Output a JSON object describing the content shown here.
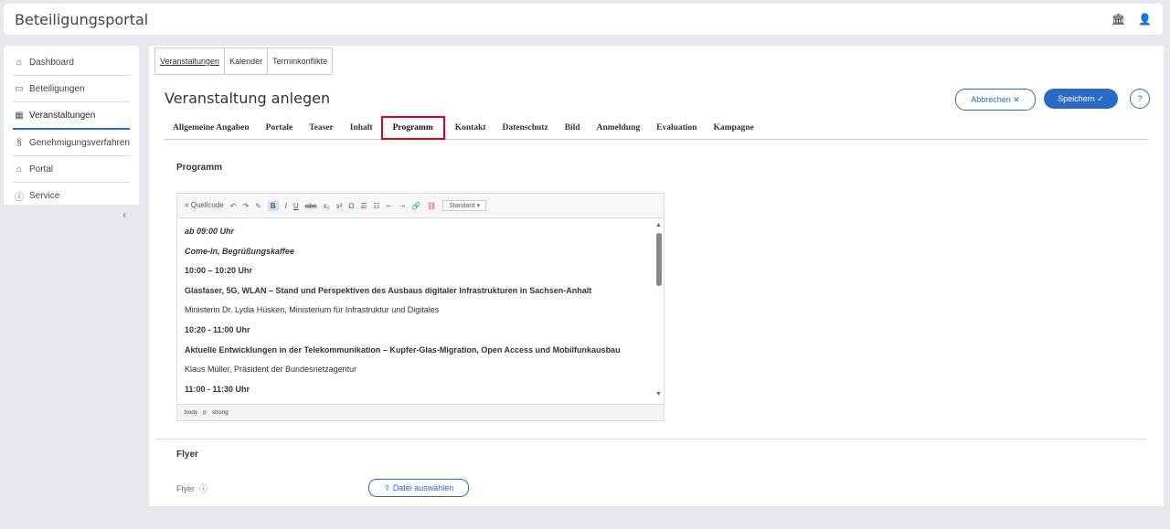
{
  "app": {
    "title": "Beteiligungsportal"
  },
  "sidebar": {
    "items": [
      {
        "icon": "home-icon",
        "label": "Dashboard"
      },
      {
        "icon": "chat-icon",
        "label": "Beteiligungen"
      },
      {
        "icon": "calendar-icon",
        "label": "Veranstaltungen"
      },
      {
        "icon": "paragraph-icon",
        "label": "Genehmigungsverfahren"
      },
      {
        "icon": "building-icon",
        "label": "Portal"
      },
      {
        "icon": "info-icon",
        "label": "Service"
      }
    ],
    "active_index": 2
  },
  "subtabs": [
    "Veranstaltungen",
    "Kalender",
    "Terminkonflikte"
  ],
  "page": {
    "title": "Veranstaltung anlegen",
    "cancel_label": "Abbrechen",
    "save_label": "Speichern"
  },
  "tabs": [
    "Allgemeine Angaben",
    "Portale",
    "Teaser",
    "Inhalt",
    "Programm",
    "Kontakt",
    "Datenschutz",
    "Bild",
    "Anmeldung",
    "Evaluation",
    "Kampagne"
  ],
  "selected_tab": "Programm",
  "program": {
    "section_title": "Programm",
    "toolbar": {
      "source_label": "Quellcode",
      "format_select": "Standard"
    },
    "content": [
      {
        "text": "ab 09:00 Uhr",
        "style": "bi"
      },
      {
        "text": "Come-In, Begrüßungskaffee",
        "style": "bi"
      },
      {
        "text": "10:00 – 10:20 Uhr",
        "style": "b"
      },
      {
        "text": "Glasfaser, 5G, WLAN – Stand und Perspektiven des Ausbaus digitaler Infrastrukturen in Sachsen-Anhalt",
        "style": "b"
      },
      {
        "text": "Ministerin Dr. Lydia Hüsken, Ministerium für Infrastruktur und Digitales",
        "style": ""
      },
      {
        "text": "10:20 - 11:00 Uhr",
        "style": "b"
      },
      {
        "text": "Aktuelle Entwicklungen in der Telekommunikation – Kupfer-Glas-Migration, Open Access und Mobilfunkausbau",
        "style": "b"
      },
      {
        "text": "Klaus Müller, Präsident der Bundesnetzagentur",
        "style": ""
      },
      {
        "text": "11:00 - 11:30 Uhr",
        "style": "b"
      }
    ],
    "statusbar": {
      "path1": "body",
      "path2": "p",
      "path3": "strong"
    }
  },
  "flyer": {
    "section_title": "Flyer",
    "field_label": "Flyer",
    "button_label": "Datei auswählen"
  },
  "colors": {
    "accent": "#2a6ac6",
    "highlight": "#e2001a"
  }
}
